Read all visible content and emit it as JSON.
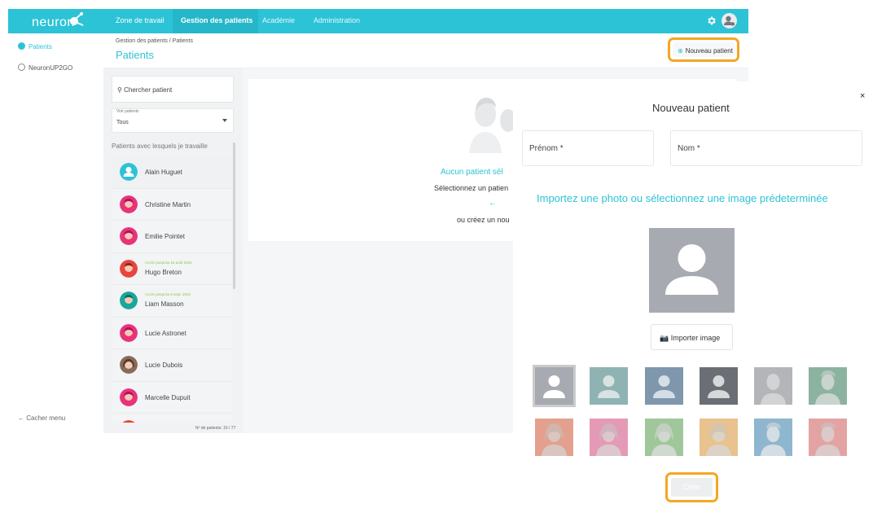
{
  "app": {
    "logo_text": "neuron"
  },
  "nav": {
    "items": [
      {
        "label": "Zone de travail"
      },
      {
        "label": "Gestion des patients"
      },
      {
        "label": "Académie"
      },
      {
        "label": "Administration"
      }
    ]
  },
  "sidebar": {
    "items": [
      {
        "label": "Patients"
      },
      {
        "label": "NeuronUP2GO"
      }
    ],
    "hide_menu": "← Cacher menu"
  },
  "header": {
    "breadcrumb": "Gestion des patients  /  Patients",
    "title": "Patients",
    "new_patient_label": "Nouveau patient"
  },
  "patients_panel": {
    "search_placeholder": "Chercher patient",
    "filter_label": "Voir patients",
    "filter_value": "Tous",
    "list_title": "Patients avec lesquels je travaille",
    "count_text": "Nº de patients: 15 / 77",
    "patients": [
      {
        "name": "Alain Huguet",
        "note": ""
      },
      {
        "name": "Christine Martin",
        "note": ""
      },
      {
        "name": "Emilie Pointet",
        "note": ""
      },
      {
        "name": "Hugo Breton",
        "note": "Accès jusqu'au 16 août 2022"
      },
      {
        "name": "Liam Masson",
        "note": "Accès jusqu'au 6 sept. 2022"
      },
      {
        "name": "Lucie Astronet",
        "note": ""
      },
      {
        "name": "Lucie Dubois",
        "note": ""
      },
      {
        "name": "Marcelle Dupuit",
        "note": ""
      }
    ]
  },
  "empty_state": {
    "title": "Aucun patient sél",
    "subtitle": "Sélectionnez un patien",
    "arrow": "←",
    "or_create": "ou créez un nou"
  },
  "modal": {
    "close": "×",
    "title": "Nouveau patient",
    "first_name_label": "Prénom *",
    "last_name_label": "Nom *",
    "import_title": "Importez une photo ou sélectionnez une image prédeterminée",
    "import_button": "Importer image",
    "create_button": "Créer"
  },
  "colors": {
    "accent": "#2cc3d6",
    "highlight": "#f5a623",
    "thumbs_row1": [
      "#a7abb1",
      "#8fb3b3",
      "#7f97ad",
      "#6b6f75",
      "#b3b5b8",
      "#8bb3a0"
    ],
    "thumbs_row2": [
      "#e3a08e",
      "#e49ab6",
      "#9fc79a",
      "#e9c28e",
      "#8fb6cf",
      "#e3a3a3"
    ]
  }
}
